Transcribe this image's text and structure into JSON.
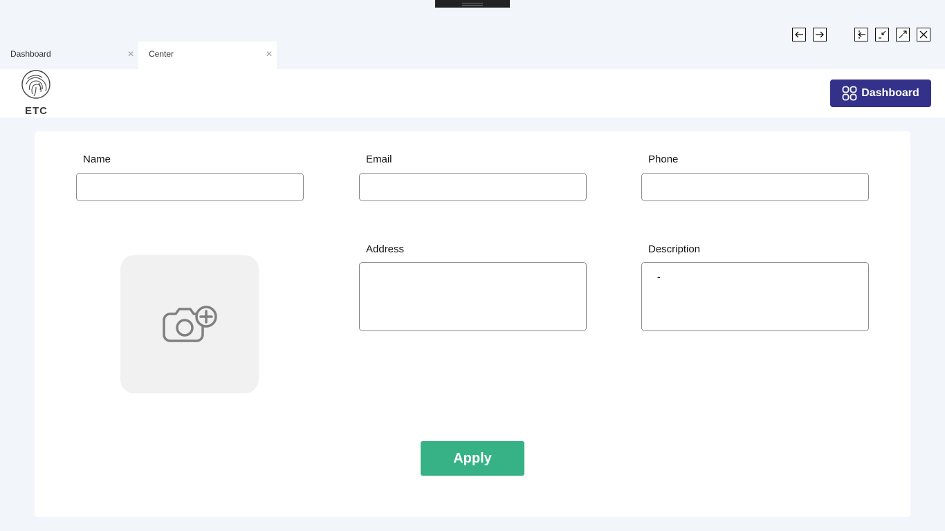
{
  "tabs": [
    {
      "label": "Dashboard",
      "close": "×",
      "active": false
    },
    {
      "label": "Center",
      "close": "×",
      "active": true
    }
  ],
  "window_controls": [
    "arrow-left-icon",
    "arrow-right-icon",
    "sign-in-icon",
    "restore-icon",
    "maximize-icon",
    "close-icon"
  ],
  "logo": {
    "text": "ETC",
    "icon": "globe-fingerprint-icon"
  },
  "header": {
    "dashboard_button": "Dashboard",
    "dashboard_icon": "grid-icon",
    "accent": "#34318a"
  },
  "form": {
    "name_label": "Name",
    "email_label": "Email",
    "phone_label": "Phone",
    "address_label": "Address",
    "description_label": "Description",
    "name_value": "",
    "email_value": "",
    "phone_value": "",
    "address_value": "",
    "description_value": "-",
    "photo_icon": "camera-add-icon",
    "apply_label": "Apply",
    "apply_color": "#36b286"
  }
}
